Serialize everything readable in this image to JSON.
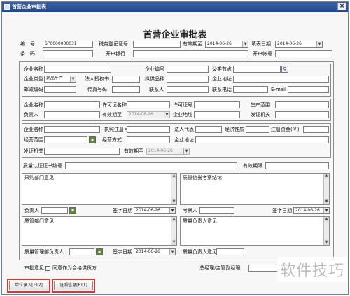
{
  "window": {
    "title": "首营企业审批表",
    "close_glyph": "×"
  },
  "form": {
    "title": "首营企业审批表"
  },
  "header": {
    "no_label": "编　号",
    "no_value": "SP0000000031",
    "tax_label": "税务登记证号",
    "valid_label": "有效期至",
    "valid_value": "2014-06-26",
    "fill_date_label": "填表日期",
    "fill_date_value": "2014-06-26",
    "barcode_label": "条　码",
    "bank_label": "开户银行",
    "account_label": "开户帐号"
  },
  "company": {
    "name_label": "企业名称",
    "code_label": "企业编号",
    "parent_label": "父类节点",
    "type_label": "企业类型",
    "type_value": "药品生产",
    "legal_label": "法人授权书",
    "plan_label": "拟供品种",
    "addr_label": "企业地址",
    "zip_label": "邮政编码",
    "fax_label": "传真号码",
    "contact_label": "联系人",
    "phone_label": "联系电话",
    "email_label": "E-mail"
  },
  "license": {
    "name_label": "企业名称",
    "lic_name_label": "许可证名称",
    "lic_no_label": "许可证号",
    "scope_label": "生产范围",
    "person_label": "负责人",
    "valid_label": "有效期至",
    "valid_value": "2014-06-26",
    "addr_label": "企业地址",
    "authority_label": "发证机关"
  },
  "business": {
    "name_label": "企业名称",
    "reg_label": "执照注册号",
    "rep_label": "法人代表",
    "nature_label": "经济性质",
    "capital_label": "注册资金(￥)",
    "scope_label": "经营范围",
    "mode_label": "经营方式",
    "addr_label": "企业地址",
    "authority_label": "发证机关",
    "valid_label": "有效期至",
    "valid_value": "2014-06-26"
  },
  "quality": {
    "cert_label": "质量认证证书编号",
    "valid_label": "有效期限"
  },
  "opinions": {
    "purchase_title": "采购部门意见",
    "qa_survey_title": "质量信誉考察结论",
    "owner_label": "负责人",
    "sign_date_label": "签字日期",
    "date_value": "2014-06-26",
    "inspector_label": "考察人",
    "qm_dept_title": "质管部门意见",
    "qm_manager_title": "质量负责人意见",
    "qm_dept_owner_label": "质量管理部负责人",
    "qm_owner_label": "质量负责人意见",
    "review_label": "审批意见",
    "agree_label": "同意作为合格供货方",
    "gm_label": "总经理/主管副经理"
  },
  "footer": {
    "unit_entry": "单位录入[F12]",
    "cert_info": "证照信息[F11]"
  },
  "watermark": "软件技巧",
  "colors": {
    "titlebar": "#2c4f94",
    "highlight": "#d23a3a"
  }
}
